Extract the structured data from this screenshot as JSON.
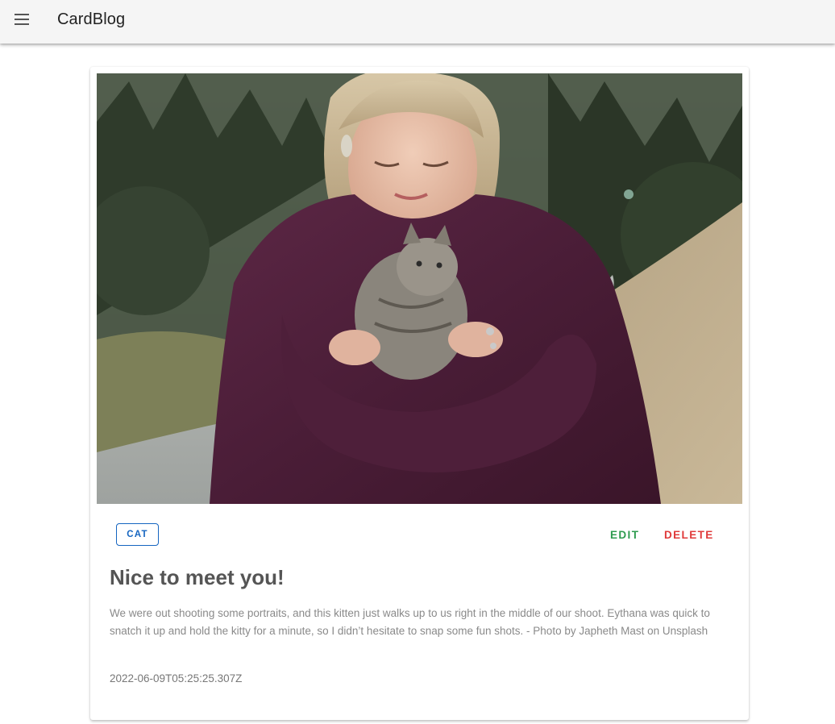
{
  "appbar": {
    "title": "CardBlog",
    "menu_icon": "menu-icon"
  },
  "post": {
    "image_alt": "Woman in a maroon sweater holding a tabby kitten on a forest road",
    "tag": "CAT",
    "actions": {
      "edit_label": "EDIT",
      "delete_label": "DELETE"
    },
    "title": "Nice to meet you!",
    "body": "We were out shooting some portraits, and this kitten just walks up to us right in the middle of our shoot. Eythana was quick to snatch it up and hold the kitty for a minute, so I didn’t hesitate to snap some fun shots. - Photo by Japheth Mast on Unsplash",
    "timestamp": "2022-06-09T05:25:25.307Z"
  },
  "colors": {
    "tag": "#1565c0",
    "edit": "#2e9b4f",
    "delete": "#e03a3a",
    "appbar_bg": "#f5f5f5"
  }
}
